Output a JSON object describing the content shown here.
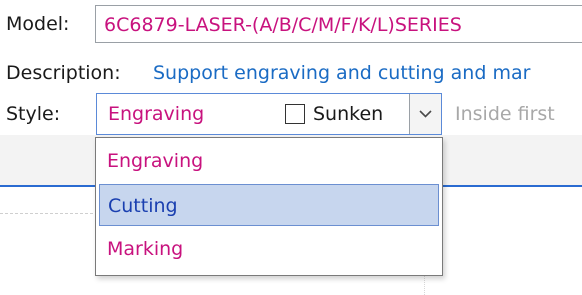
{
  "model": {
    "label": "Model:",
    "value": "6C6879-LASER-(A/B/C/M/F/K/L)SERIES"
  },
  "description": {
    "label": "Description:",
    "value": "Support engraving and cutting and mar"
  },
  "style": {
    "label": "Style:",
    "selected": "Engraving",
    "sunken_label": "Sunken",
    "sunken_checked": false,
    "next_field_text": "Inside first",
    "dropdown_options": [
      {
        "label": "Engraving",
        "highlighted": false
      },
      {
        "label": "Cutting",
        "highlighted": true
      },
      {
        "label": "Marking",
        "highlighted": false
      }
    ]
  },
  "colors": {
    "value_text": "#c8127e",
    "link_text": "#1a6bc4",
    "selected_text": "#1a3fb0",
    "selection_bg": "#c7d6ee",
    "accent_line": "#2a6bd1"
  },
  "icons": {
    "dropdown_arrow": "chevron-down-icon",
    "checkbox": "checkbox-unchecked-icon"
  }
}
